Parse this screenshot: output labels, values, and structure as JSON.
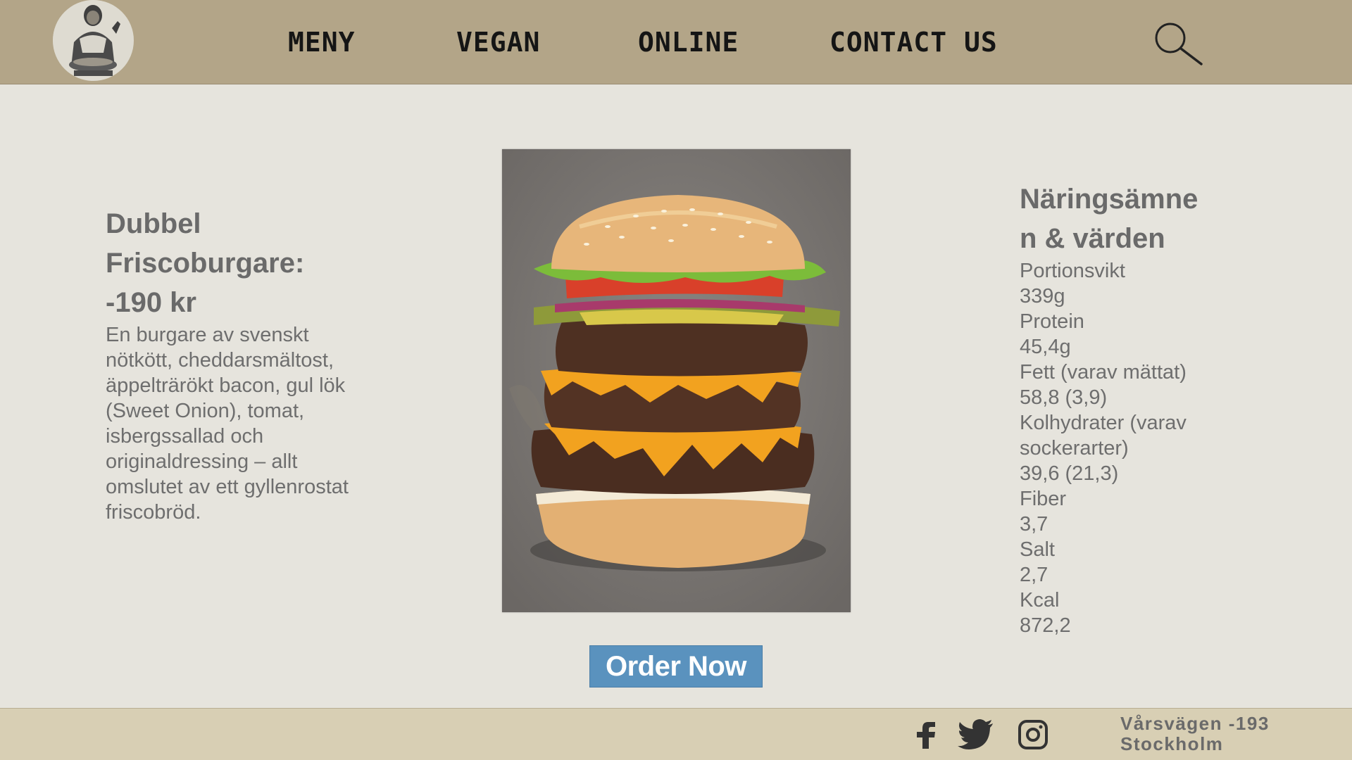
{
  "nav": {
    "logo_icon": "chef-mascot-logo",
    "items": [
      "MENY",
      "VEGAN",
      "ONLINE",
      "CONTACT US"
    ],
    "search_icon": "search-icon"
  },
  "product": {
    "title_lines": [
      "Dubbel",
      "Friscoburgare:",
      "-190 kr"
    ],
    "description": "En burgare av svenskt nötkött, cheddarsmältost, äppelträrökt bacon, gul lök (Sweet Onion), tomat, isbergssallad och originaldressing – allt omslutet av ett gyllenrostat friscobröd.",
    "image": "double-cheeseburger-photo"
  },
  "order_button": {
    "label": "Order Now"
  },
  "nutrition": {
    "title_lines": [
      "Näringsämne",
      "n & värden"
    ],
    "lines": [
      "Portionsvikt",
      "339g",
      "Protein",
      "45,4g",
      "Fett (varav mättat)",
      "58,8 (3,9)",
      "Kolhydrater (varav",
      "sockerarter)",
      "39,6 (21,3)",
      "Fiber",
      "3,7",
      "Salt",
      "2,7",
      "Kcal",
      "872,2"
    ]
  },
  "footer": {
    "social_icons": [
      "facebook-icon",
      "twitter-icon",
      "instagram-icon"
    ],
    "address_lines": [
      "Vårsvägen -193",
      "Stockholm"
    ]
  },
  "colors": {
    "header_bg": "#b3a588",
    "page_bg": "#e6e4dd",
    "footer_bg": "#d8cfb4",
    "button_bg": "#5a92be",
    "text_gray": "#6a6a6a"
  }
}
